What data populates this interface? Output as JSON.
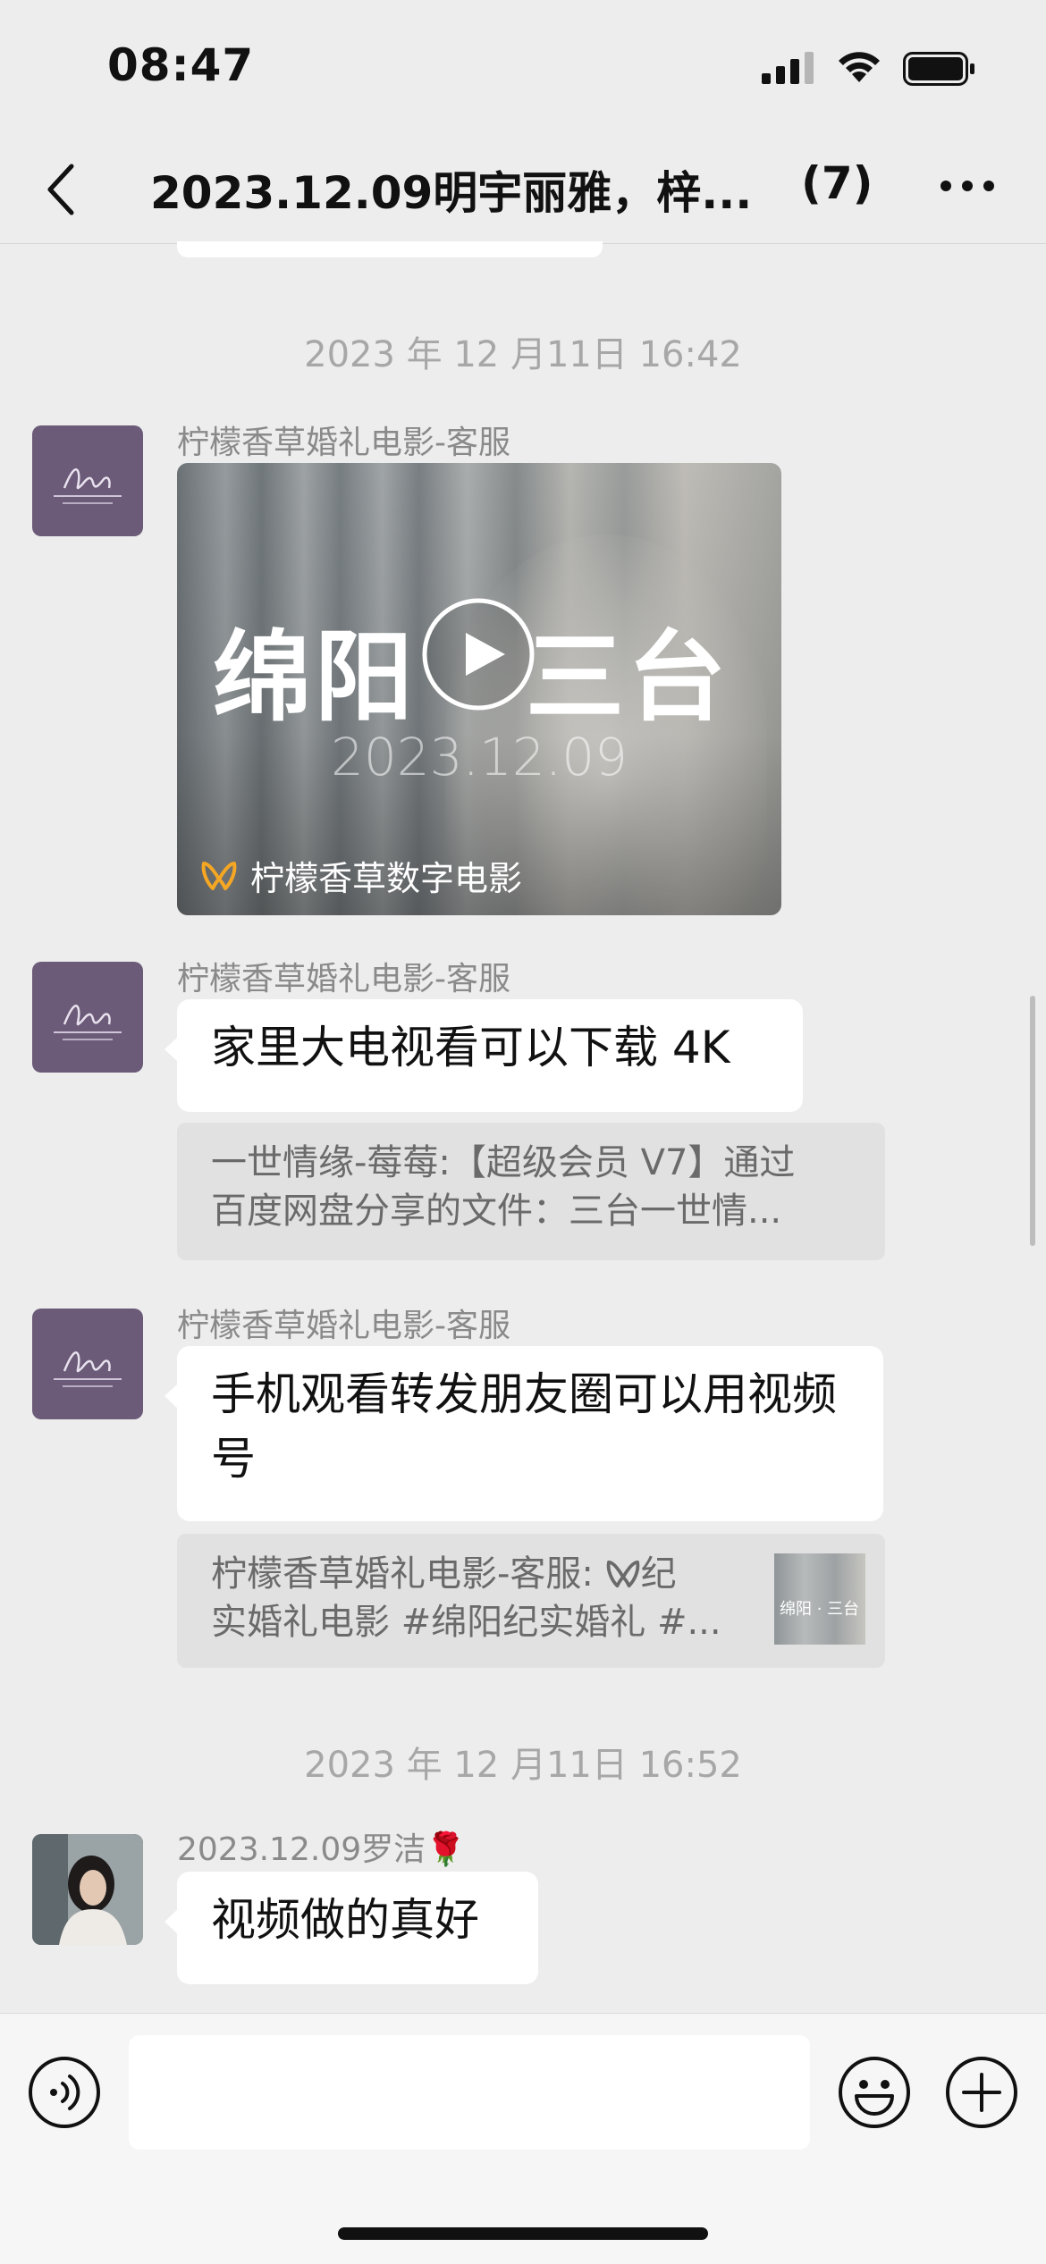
{
  "status_bar": {
    "time": "08:47"
  },
  "nav": {
    "title": "2023.12.09明宇丽雅，梓...",
    "count": "(7)"
  },
  "messages": {
    "ts1": "2023 年 12 月11日 16:42",
    "video": {
      "sender": "柠檬香草婚礼电影-客服",
      "title_left": "绵阳",
      "title_right": "三台",
      "date": "2023.12.09",
      "brand": "柠檬香草数字电影"
    },
    "msg2": {
      "sender": "柠檬香草婚礼电影-客服",
      "text": "家里大电视看可以下载 4K",
      "quote_line1": "一世情缘-莓莓:【超级会员 V7】通过",
      "quote_line2": "百度网盘分享的文件：三台一世情..."
    },
    "msg3": {
      "sender": "柠檬香草婚礼电影-客服",
      "text": "手机观看转发朋友圈可以用视频号",
      "quote_line1": "柠檬香草婚礼电影-客服: ",
      "quote_line1b": "纪",
      "quote_line2": "实婚礼电影 #绵阳纪实婚礼 #...",
      "thumb_text": "绵阳 · 三台"
    },
    "ts2": "2023 年 12 月11日 16:52",
    "msg4": {
      "sender": "2023.12.09罗洁🌹",
      "text": "视频做的真好"
    }
  },
  "icons": {
    "back": "chevron-left-icon",
    "more": "more-dots-icon",
    "voice": "voice-icon",
    "emoji": "emoji-icon",
    "plus": "plus-icon"
  },
  "colors": {
    "background": "#ededed",
    "bubble": "#ffffff",
    "quote": "#e1e1e1",
    "brand_avatar": "#6b5a78",
    "brand_orange": "#f5a623"
  }
}
